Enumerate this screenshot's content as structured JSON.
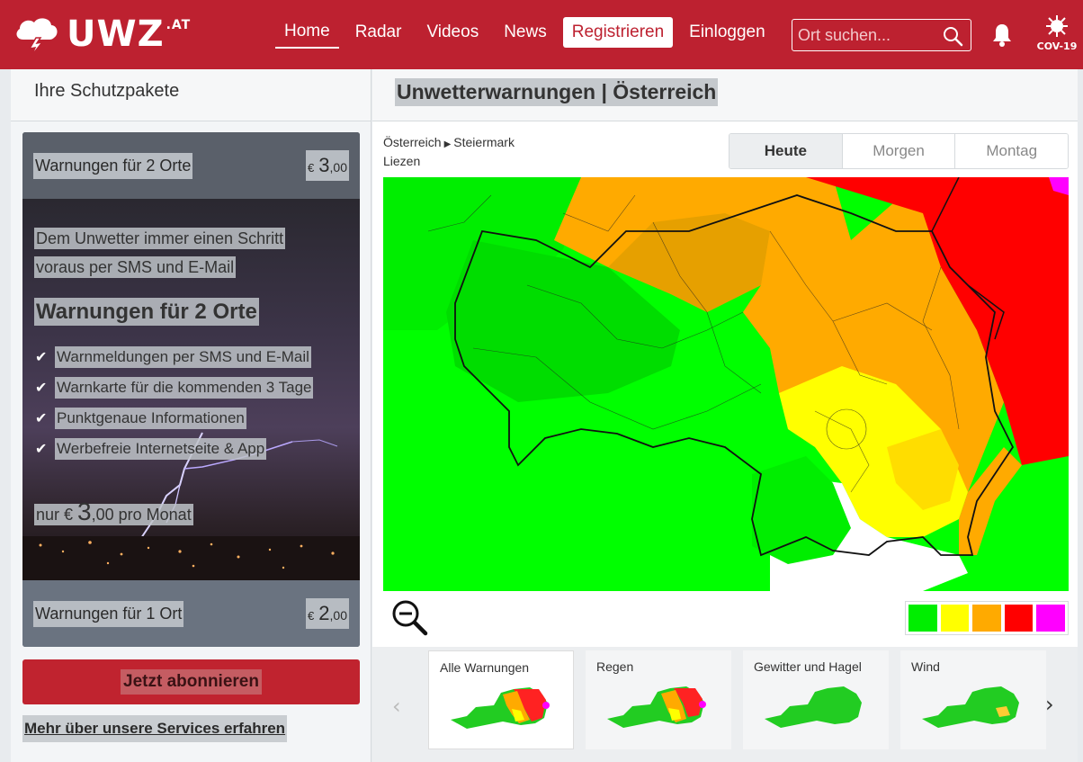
{
  "header": {
    "logo_text": "UWZ",
    "logo_sup": ".AT",
    "nav": [
      "Home",
      "Radar",
      "Videos",
      "News"
    ],
    "register": "Registrieren",
    "login": "Einloggen",
    "search_placeholder": "Ort suchen...",
    "covid": "COV-19",
    "brand_color": "#bd2130"
  },
  "left": {
    "heading": "Ihre Schutzpakete",
    "package_top": {
      "label": "Warnungen für 2 Orte",
      "currency": "€",
      "price_main": "3",
      "price_dec": ",00"
    },
    "hero": {
      "tagline_1": "Dem Unwetter immer einen Schritt",
      "tagline_2": "voraus per SMS und E-Mail",
      "title": "Warnungen für 2 Orte",
      "features": [
        "Warnmeldungen per SMS und E-Mail",
        "Warnkarte für die kommenden 3 Tage",
        "Punktgenaue Informationen",
        "Werbefreie Internetseite & App"
      ],
      "price_prefix": "nur €",
      "price_main": "3",
      "price_suffix": ",00 pro Monat"
    },
    "package_bottom": {
      "label": "Warnungen für 1 Ort",
      "currency": "€",
      "price_main": "2",
      "price_dec": ",00"
    },
    "cta": "Jetzt abonnieren",
    "more_link": "Mehr über unsere Services erfahren"
  },
  "right": {
    "title": "Unwetterwarnungen | Österreich",
    "breadcrumb": {
      "country": "Österreich",
      "state": "Steiermark",
      "district": "Liezen"
    },
    "days": [
      "Heute",
      "Morgen",
      "Montag"
    ],
    "active_day": "Heute",
    "legend_colors": [
      "#00ee00",
      "#ffff00",
      "#ffaa00",
      "#ff0000",
      "#ff00ff"
    ],
    "thumbnails": [
      "Alle Warnungen",
      "Regen",
      "Gewitter und Hagel",
      "Wind"
    ]
  }
}
